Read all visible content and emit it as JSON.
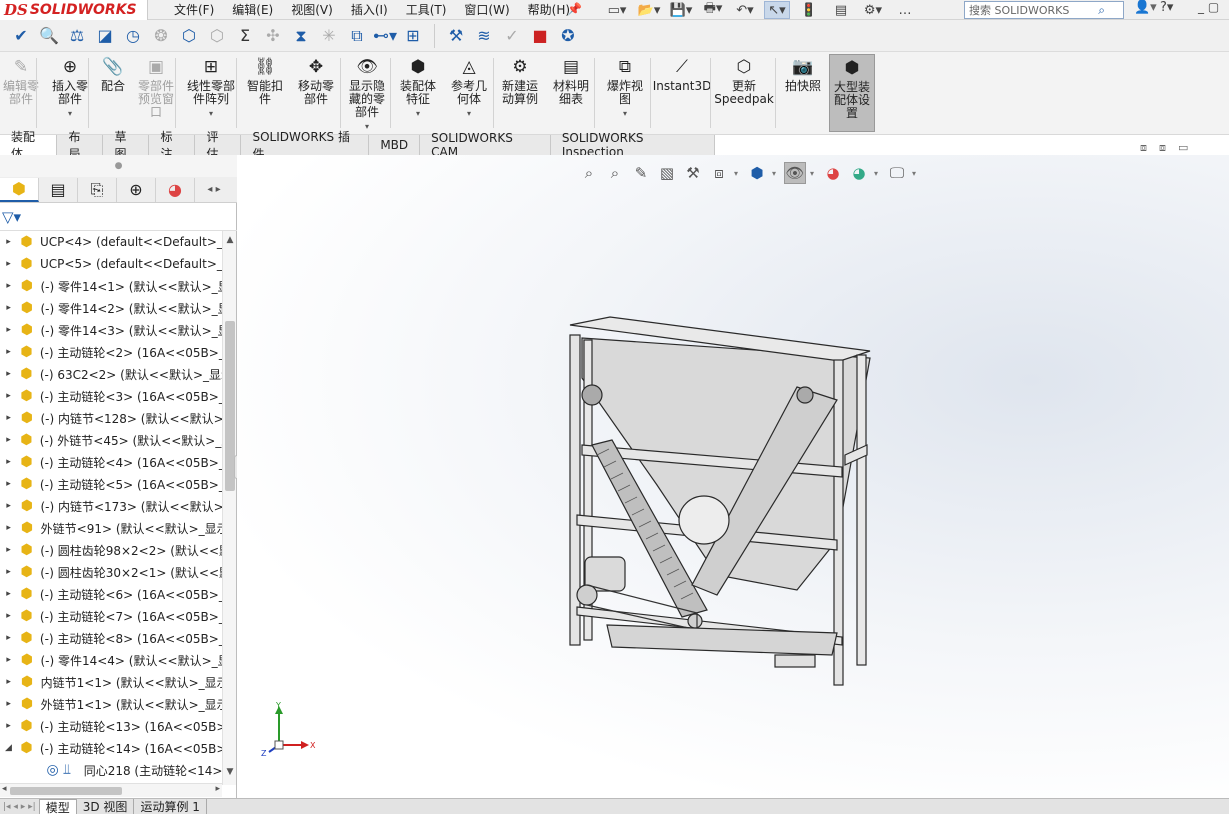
{
  "app": {
    "logo_ds": "DS",
    "logo_name": "SOLIDWORKS"
  },
  "menu": [
    "文件(F)",
    "编辑(E)",
    "视图(V)",
    "插入(I)",
    "工具(T)",
    "窗口(W)",
    "帮助(H)"
  ],
  "search": {
    "placeholder": "搜索 SOLIDWORKS"
  },
  "commands": [
    {
      "label": "编辑零\n部件",
      "icon": "edit-component-icon",
      "disabled": true
    },
    {
      "label": "插入零\n部件",
      "icon": "insert-component-icon",
      "disabled": false
    },
    {
      "label": "配合",
      "icon": "mate-icon",
      "disabled": false
    },
    {
      "label": "零部件\n预览窗\n口",
      "icon": "component-preview-icon",
      "disabled": true
    },
    {
      "label": "线性零部\n件阵列",
      "icon": "linear-pattern-icon",
      "disabled": false
    },
    {
      "label": "智能扣\n件",
      "icon": "smart-fastener-icon",
      "disabled": false
    },
    {
      "label": "移动零\n部件",
      "icon": "move-component-icon",
      "disabled": false
    },
    {
      "label": "显示隐\n藏的零\n部件",
      "icon": "show-hidden-icon",
      "disabled": false
    },
    {
      "label": "装配体\n特征",
      "icon": "assembly-feature-icon",
      "disabled": false
    },
    {
      "label": "参考几\n何体",
      "icon": "reference-geometry-icon",
      "disabled": false
    },
    {
      "label": "新建运\n动算例",
      "icon": "motion-study-icon",
      "disabled": false
    },
    {
      "label": "材料明\n细表",
      "icon": "bom-icon",
      "disabled": false
    },
    {
      "label": "爆炸视\n图",
      "icon": "exploded-view-icon",
      "disabled": false
    },
    {
      "label": "Instant3D",
      "icon": "instant3d-icon",
      "disabled": false
    },
    {
      "label": "更新\nSpeedpak",
      "icon": "speedpak-icon",
      "disabled": false
    },
    {
      "label": "拍快照",
      "icon": "snapshot-icon",
      "disabled": false
    },
    {
      "label": "大型装\n配体设\n置",
      "icon": "large-assembly-icon",
      "disabled": false,
      "active": true
    }
  ],
  "tabs": [
    "装配体",
    "布局",
    "草图",
    "标注",
    "评估",
    "SOLIDWORKS 插件",
    "MBD",
    "SOLIDWORKS CAM",
    "SOLIDWORKS Inspection"
  ],
  "active_tab": "装配体",
  "tree": [
    {
      "text": "UCP<4> (default<<Default>_D",
      "minus": false
    },
    {
      "text": "UCP<5> (default<<Default>_D",
      "minus": false
    },
    {
      "text": "(-) 零件14<1> (默认<<默认>_显",
      "minus": true
    },
    {
      "text": "(-) 零件14<2> (默认<<默认>_显",
      "minus": true
    },
    {
      "text": "(-) 零件14<3> (默认<<默认>_显",
      "minus": true
    },
    {
      "text": "(-) 主动链轮<2> (16A<<05B>_5",
      "minus": true
    },
    {
      "text": "(-) 63C2<2> (默认<<默认>_显示",
      "minus": true
    },
    {
      "text": "(-) 主动链轮<3> (16A<<05B>_5",
      "minus": true
    },
    {
      "text": "(-) 内链节<128> (默认<<默认>_",
      "minus": true
    },
    {
      "text": "(-) 外链节<45> (默认<<默认>_显",
      "minus": true
    },
    {
      "text": "(-) 主动链轮<4> (16A<<05B>_5",
      "minus": true
    },
    {
      "text": "(-) 主动链轮<5> (16A<<05B>_5",
      "minus": true
    },
    {
      "text": "(-) 内链节<173> (默认<<默认>_",
      "minus": true
    },
    {
      "text": "外链节<91> (默认<<默认>_显示",
      "minus": false
    },
    {
      "text": "(-) 圆柱齿轮98×2<2> (默认<<默",
      "minus": true
    },
    {
      "text": "(-) 圆柱齿轮30×2<1> (默认<<默",
      "minus": true
    },
    {
      "text": "(-) 主动链轮<6> (16A<<05B>_5",
      "minus": true
    },
    {
      "text": "(-) 主动链轮<7> (16A<<05B>_5",
      "minus": true
    },
    {
      "text": "(-) 主动链轮<8> (16A<<05B>_5",
      "minus": true
    },
    {
      "text": "(-) 零件14<4> (默认<<默认>_显",
      "minus": true
    },
    {
      "text": "内链节1<1> (默认<<默认>_显示",
      "minus": false
    },
    {
      "text": "外链节1<1> (默认<<默认>_显示",
      "minus": false
    },
    {
      "text": "(-) 主动链轮<13> (16A<<05B>_",
      "minus": true
    },
    {
      "text": "(-) 主动链轮<14> (16A<<05B>_",
      "minus": true,
      "expanded": true
    },
    {
      "text": "同心218 (主动链轮<14>",
      "minus": false,
      "child": true
    }
  ],
  "triad": {
    "x": "X",
    "y": "Y",
    "z": "Z"
  },
  "bottom_tabs": [
    "模型",
    "3D 视图",
    "运动算例 1"
  ],
  "active_bottom_tab": "模型",
  "colors": {
    "accent": "#1f5da8",
    "brand": "#d42222",
    "part_yellow": "#e7b416"
  }
}
